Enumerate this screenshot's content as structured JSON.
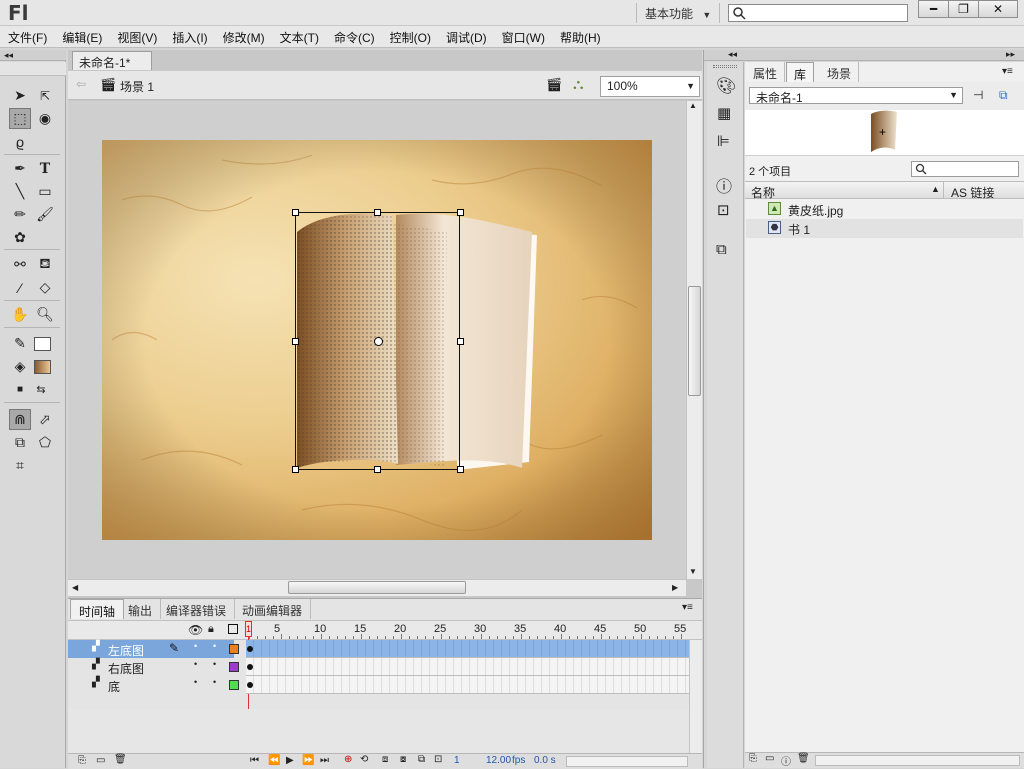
{
  "app": {
    "logo": "Fl",
    "workspace_label": "基本功能"
  },
  "menu": [
    "文件(F)",
    "编辑(E)",
    "视图(V)",
    "插入(I)",
    "修改(M)",
    "文本(T)",
    "命令(C)",
    "控制(O)",
    "调试(D)",
    "窗口(W)",
    "帮助(H)"
  ],
  "document": {
    "tab_label": "未命名-1*",
    "tab_close": "×",
    "scene_label": "场景 1",
    "zoom": "100%"
  },
  "timeline": {
    "tabs": [
      "时间轴",
      "输出",
      "编译器错误",
      "动画编辑器"
    ],
    "frame_numbers": [
      "1",
      "5",
      "10",
      "15",
      "20",
      "25",
      "30",
      "35",
      "40",
      "45",
      "50",
      "55"
    ],
    "layers": [
      {
        "name": "左底图",
        "color": "#f07f1a",
        "selected": true
      },
      {
        "name": "右底图",
        "color": "#9b3bd0",
        "selected": false
      },
      {
        "name": "底",
        "color": "#4ede4e",
        "selected": false
      }
    ],
    "current_frame": "1",
    "fps": "12.00",
    "fps_unit": "fps",
    "time": "0.0 s"
  },
  "library": {
    "tabs": [
      "属性",
      "库",
      "场景"
    ],
    "document_select": "未命名-1",
    "item_count": "2 个项目",
    "col_name": "名称",
    "col_linkage": "AS 链接",
    "items": [
      {
        "name": "黄皮纸.jpg",
        "type": "bitmap"
      },
      {
        "name": "书 1",
        "type": "graphic"
      }
    ]
  },
  "colors": {
    "selected_layer": "#7aa6dc",
    "playhead": "#e03030"
  }
}
